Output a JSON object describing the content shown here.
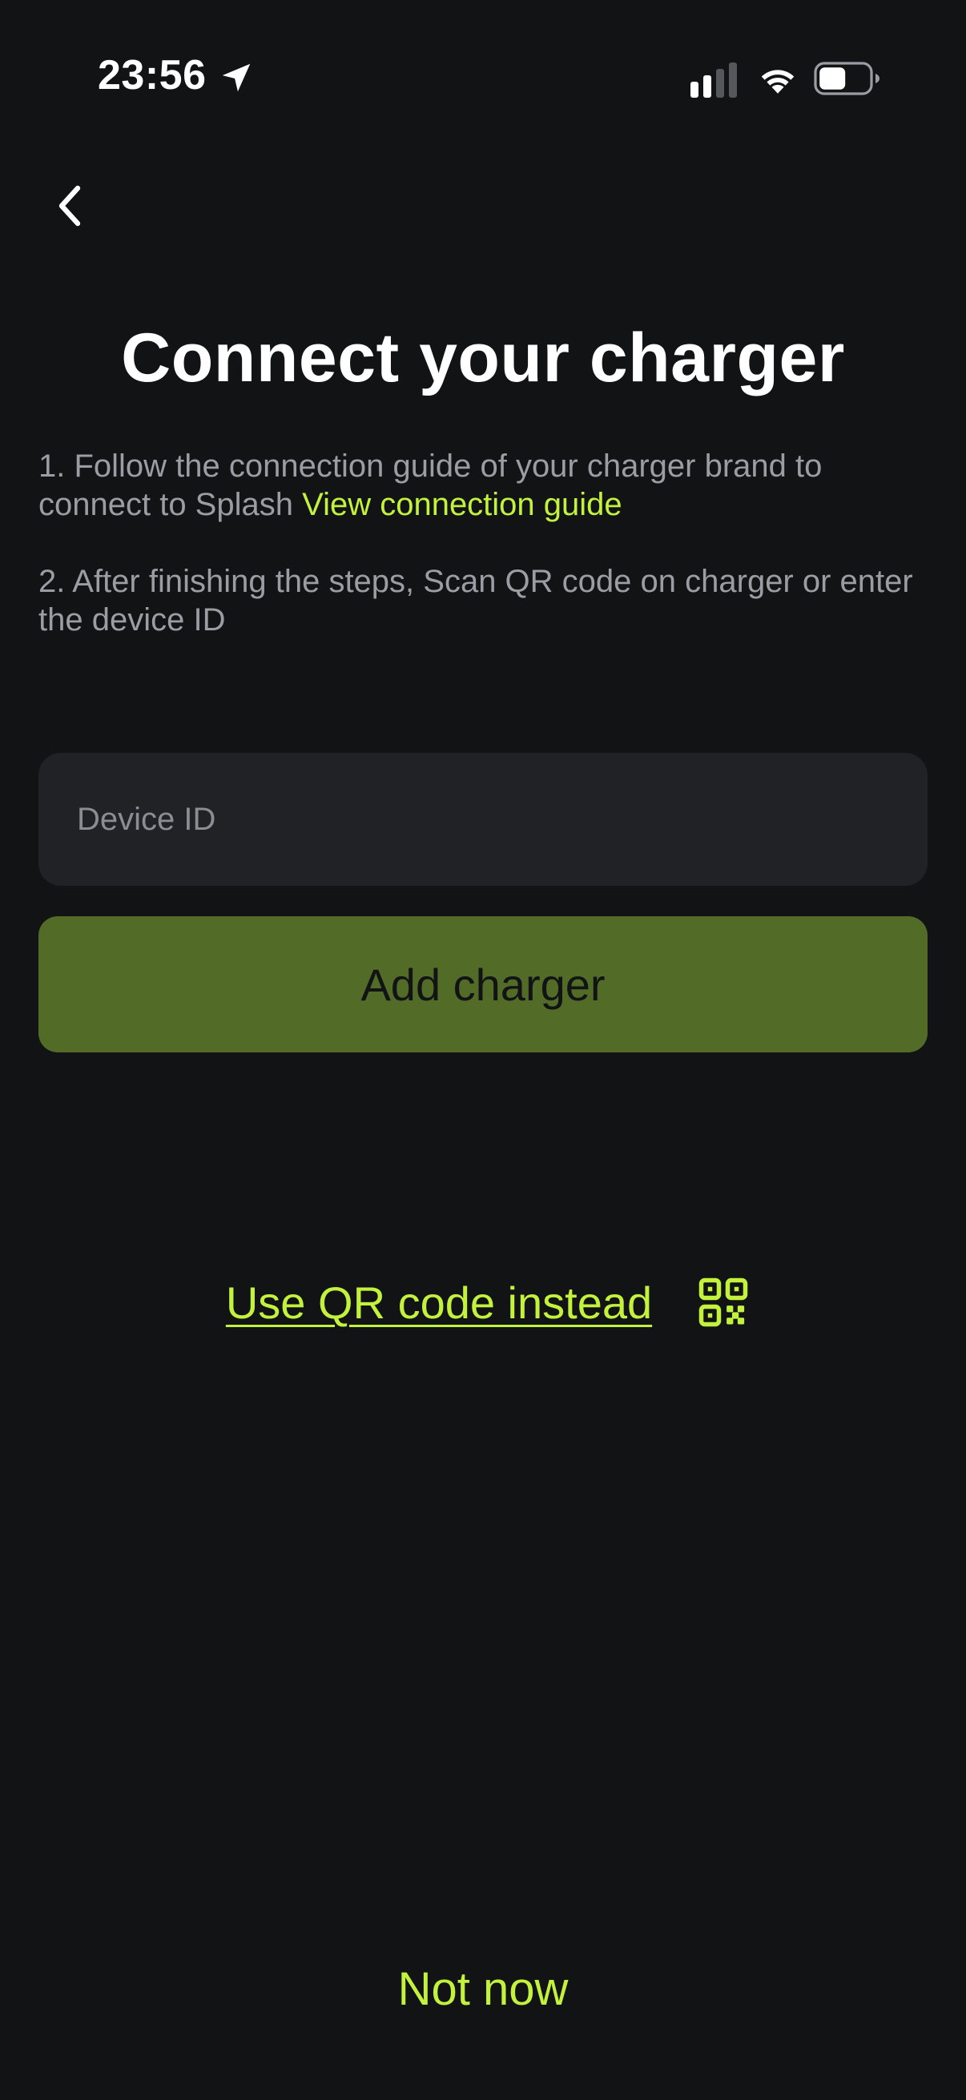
{
  "status_bar": {
    "time": "23:56",
    "icons": [
      "location-arrow-icon",
      "cellular-signal-icon",
      "wifi-icon",
      "battery-icon"
    ]
  },
  "header": {
    "back_icon": "chevron-left-icon",
    "title": "Connect your charger"
  },
  "instructions": {
    "step1_text": "1. Follow the connection guide of your charger brand to connect to Splash ",
    "step1_link": "View connection guide",
    "step2_text": "2. After finishing the steps, Scan QR code on charger or enter the device ID"
  },
  "form": {
    "device_id_value": "",
    "device_id_placeholder": "Device ID",
    "add_button_label": "Add charger"
  },
  "alternate": {
    "qr_label": "Use QR code instead",
    "qr_icon": "qr-code-icon"
  },
  "footer": {
    "not_now_label": "Not now"
  },
  "colors": {
    "background": "#121315",
    "accent": "#c3f23c",
    "button_bg": "#526c28",
    "input_bg": "#212226",
    "muted_text": "#9a9da3"
  }
}
